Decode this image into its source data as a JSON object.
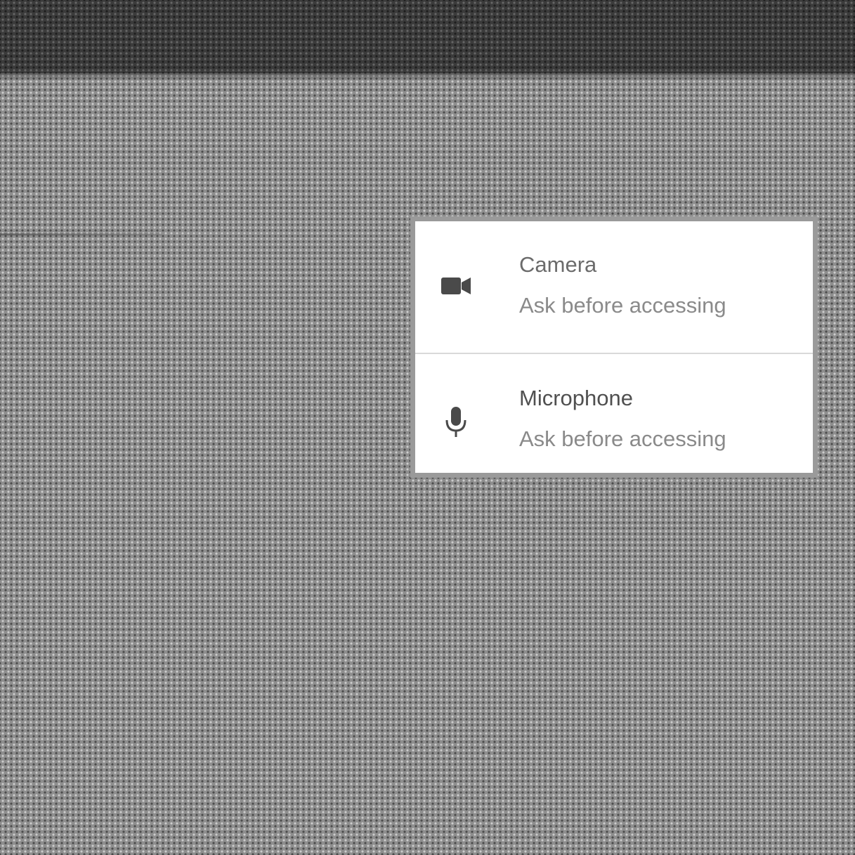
{
  "permissions": [
    {
      "title": "Camera",
      "status": "Ask before accessing",
      "icon": "camera-icon"
    },
    {
      "title": "Microphone",
      "status": "Ask before accessing",
      "icon": "microphone-icon"
    }
  ],
  "colors": {
    "panel_background": "#ffffff",
    "page_background": "#8e8e8e",
    "top_bar": "#3b3b3b"
  }
}
